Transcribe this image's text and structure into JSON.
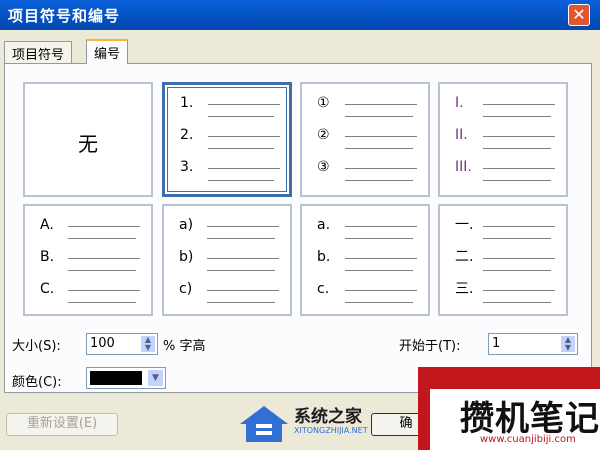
{
  "window": {
    "title": "项目符号和编号",
    "close_glyph": "✕"
  },
  "tabs": [
    {
      "label": "项目符号",
      "active": false
    },
    {
      "label": "编号",
      "active": true
    }
  ],
  "gallery": {
    "none_label": "无",
    "tiles": [
      {
        "name": "numbering-decimal",
        "markers": [
          "1.",
          "2.",
          "3."
        ],
        "selected": true
      },
      {
        "name": "numbering-circled",
        "markers": [
          "①",
          "②",
          "③"
        ]
      },
      {
        "name": "numbering-roman",
        "markers": [
          "I.",
          "II.",
          "III."
        ],
        "marker_color": "#7a2a8a"
      },
      {
        "name": "numbering-upper-alpha",
        "markers": [
          "A.",
          "B.",
          "C."
        ]
      },
      {
        "name": "numbering-alpha-paren",
        "markers": [
          "a)",
          "b)",
          "c)"
        ]
      },
      {
        "name": "numbering-lower-alpha",
        "markers": [
          "a.",
          "b.",
          "c."
        ]
      },
      {
        "name": "numbering-chinese",
        "markers": [
          "一.",
          "二.",
          "三."
        ]
      }
    ]
  },
  "size": {
    "label": "大小(S):",
    "value": "100",
    "suffix": "% 字高"
  },
  "color": {
    "label": "颜色(C):",
    "value": "#000000"
  },
  "start_at": {
    "label": "开始于(T):",
    "value": "1"
  },
  "buttons": {
    "reset_label": "重新设置(E)",
    "ok_label": "确"
  },
  "watermarks": {
    "left": {
      "text": "系统之家",
      "sub": "XITONGZHIJIA.NET"
    },
    "right": {
      "text": "攒机笔记",
      "sub": "www.cuanjibiji.com"
    }
  }
}
